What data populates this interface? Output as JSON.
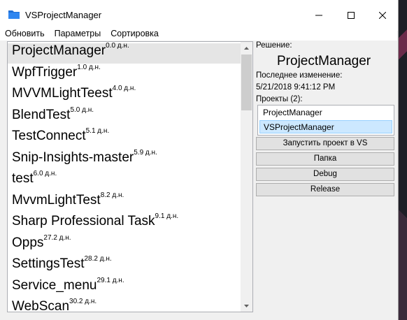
{
  "window": {
    "title": "VSProjectManager"
  },
  "menu": [
    "Обновить",
    "Параметры",
    "Сортировка"
  ],
  "projects_list": [
    {
      "name": "ProjectManager",
      "age": "0.0 д.н."
    },
    {
      "name": "WpfTrigger",
      "age": "1.0 д.н."
    },
    {
      "name": "MVVMLightTeest",
      "age": "4.0 д.н."
    },
    {
      "name": "BlendTest",
      "age": "5.0 д.н."
    },
    {
      "name": "TestConnect",
      "age": "5.1 д.н."
    },
    {
      "name": "Snip-Insights-master",
      "age": "5.9 д.н."
    },
    {
      "name": "test",
      "age": "6.0 д.н."
    },
    {
      "name": "MvvmLightTest",
      "age": "8.2 д.н."
    },
    {
      "name": "Sharp Professional Task",
      "age": "9.1 д.н."
    },
    {
      "name": "Opps",
      "age": "27.2 д.н."
    },
    {
      "name": "SettingsTest",
      "age": "28.2 д.н."
    },
    {
      "name": "Service_menu",
      "age": "29.1 д.н."
    },
    {
      "name": "WebScan",
      "age": "30.2 д.н."
    }
  ],
  "selected_index": 0,
  "details": {
    "solution_label": "Решение:",
    "solution_name": "ProjectManager",
    "last_modified_label": "Последнее изменение:",
    "last_modified_value": "5/21/2018 9:41:12 PM",
    "projects_label": "Проекты (2):",
    "projects": [
      "ProjectManager",
      "VSProjectManager"
    ],
    "selected_project_index": 1
  },
  "buttons": {
    "run_in_vs": "Запустить проект в VS",
    "folder": "Папка",
    "debug": "Debug",
    "release": "Release"
  }
}
